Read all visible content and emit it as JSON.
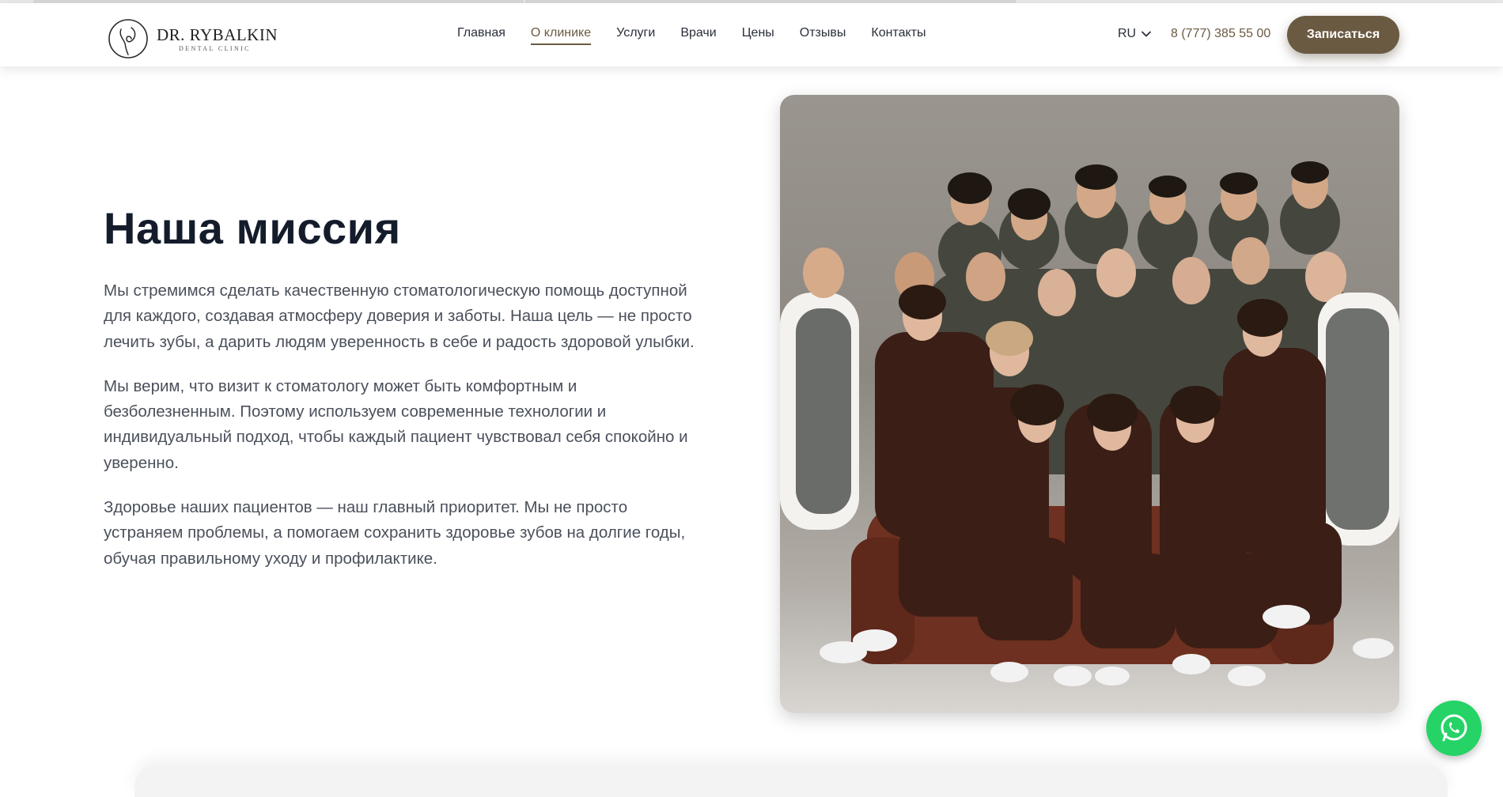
{
  "brand": {
    "name": "DR. RYBALKIN",
    "tagline": "DENTAL CLINIC",
    "accent_color": "#6b5a42",
    "whatsapp_color": "#25d366"
  },
  "nav": {
    "items": [
      {
        "label": "Главная",
        "active": false
      },
      {
        "label": "О клинике",
        "active": true
      },
      {
        "label": "Услуги",
        "active": false
      },
      {
        "label": "Врачи",
        "active": false
      },
      {
        "label": "Цены",
        "active": false
      },
      {
        "label": "Отзывы",
        "active": false
      },
      {
        "label": "Контакты",
        "active": false
      }
    ]
  },
  "header": {
    "language": "RU",
    "phone": "8 (777) 385 55 00",
    "cta_label": "Записаться"
  },
  "mission": {
    "title": "Наша миссия",
    "paragraphs": [
      "Мы стремимся сделать качественную стоматологическую помощь доступной для каждого, создавая атмосферу доверия и заботы. Наша цель — не просто лечить зубы, а дарить людям уверенность в себе и радость здоровой улыбки.",
      "Мы верим, что визит к стоматологу может быть комфортным и безболезненным. Поэтому используем современные технологии и индивидуальный подход, чтобы каждый пациент чувствовал себя спокойно и уверенно.",
      "Здоровье наших пациентов — наш главный приоритет. Мы не просто устраняем проблемы, а помогаем сохранить здоровье зубов на долгие годы, обучая правильному уходу и профилактике."
    ]
  },
  "icons": {
    "logo": "tooth-logo-icon",
    "language_chevron": "chevron-down-icon",
    "whatsapp": "whatsapp-icon"
  }
}
